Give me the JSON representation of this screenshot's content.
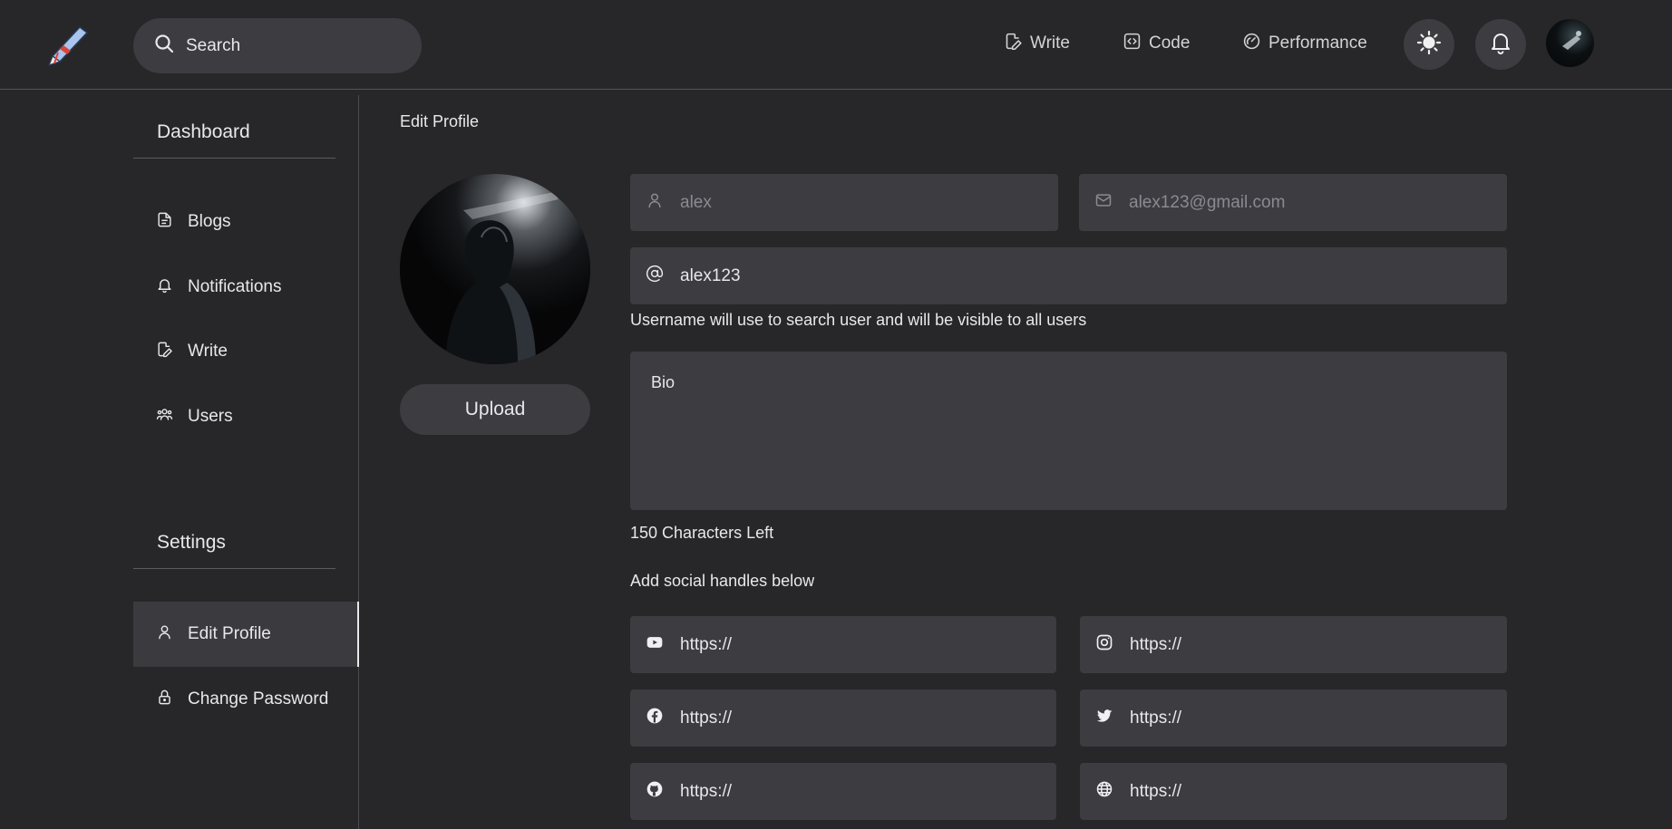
{
  "navbar": {
    "search_placeholder": "Search",
    "links": [
      {
        "label": "Write",
        "icon": "file-edit-icon"
      },
      {
        "label": "Code",
        "icon": "code-icon"
      },
      {
        "label": "Performance",
        "icon": "gauge-icon"
      }
    ],
    "theme_icon": "sun-icon",
    "notification_icon": "bell-icon"
  },
  "sidebar": {
    "dashboard_heading": "Dashboard",
    "dashboard_items": [
      {
        "label": "Blogs",
        "icon": "file-icon"
      },
      {
        "label": "Notifications",
        "icon": "bell-icon"
      },
      {
        "label": "Write",
        "icon": "file-edit-icon"
      },
      {
        "label": "Users",
        "icon": "users-icon"
      }
    ],
    "settings_heading": "Settings",
    "settings_items": [
      {
        "label": "Edit Profile",
        "icon": "user-icon",
        "active": true
      },
      {
        "label": "Change Password",
        "icon": "lock-icon",
        "active": false
      }
    ]
  },
  "main": {
    "title": "Edit Profile",
    "upload_label": "Upload",
    "name_value": "alex",
    "email_value": "alex123@gmail.com",
    "username_value": "alex123",
    "username_help": "Username will use to search user and will be visible to all users",
    "bio_placeholder": "Bio",
    "chars_left": "150 Characters Left",
    "social_heading": "Add social handles below",
    "social": [
      {
        "icon": "youtube-icon",
        "placeholder": "https://"
      },
      {
        "icon": "instagram-icon",
        "placeholder": "https://"
      },
      {
        "icon": "facebook-icon",
        "placeholder": "https://"
      },
      {
        "icon": "twitter-icon",
        "placeholder": "https://"
      },
      {
        "icon": "github-icon",
        "placeholder": "https://"
      },
      {
        "icon": "globe-icon",
        "placeholder": "https://"
      }
    ]
  },
  "colors": {
    "background": "#27272a",
    "surface": "#3c3c41",
    "text": "#e8e8ea",
    "muted_text": "#8a8a90"
  }
}
